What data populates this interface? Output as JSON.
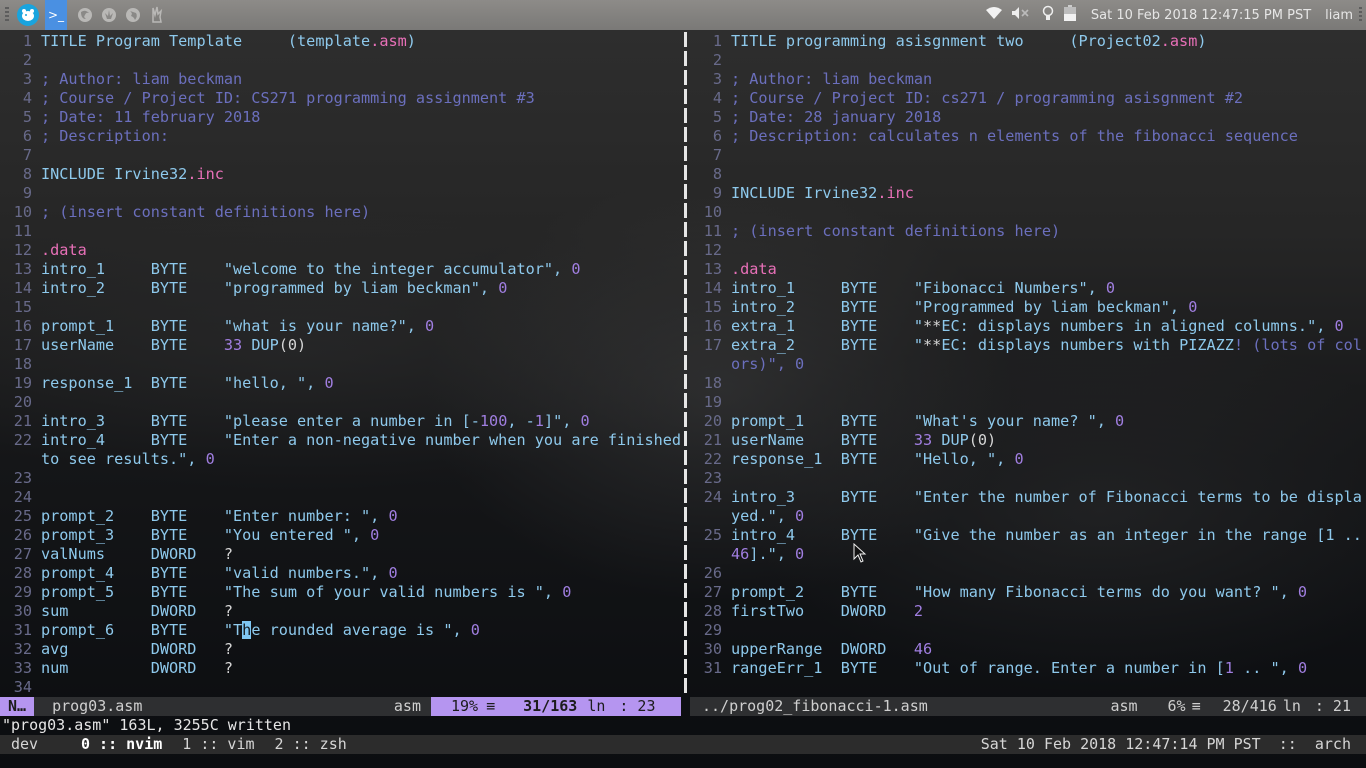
{
  "topbar": {
    "launcher_icons": [
      "app-logo",
      "terminal",
      "firefox",
      "rebel-alliance",
      "globe",
      "hand"
    ],
    "tray_icons": [
      "wifi",
      "volume-muted",
      "lightbulb",
      "battery"
    ],
    "clock": "Sat 10 Feb 2018 12:47:15 PM PST",
    "user": "liam"
  },
  "left_pane": {
    "lines": [
      {
        "n": "1",
        "parts": [
          [
            "kw",
            "TITLE Program Template     "
          ],
          [
            "kw",
            "(template"
          ],
          [
            "pk",
            ".asm"
          ],
          [
            "kw",
            ")"
          ]
        ]
      },
      {
        "n": "2",
        "parts": []
      },
      {
        "n": "3",
        "parts": [
          [
            "cm",
            "; Author: liam beckman"
          ]
        ]
      },
      {
        "n": "4",
        "parts": [
          [
            "cm",
            "; Course / Project ID: CS271 programming assignment #3"
          ]
        ]
      },
      {
        "n": "5",
        "parts": [
          [
            "cm",
            "; Date: 11 february 2018"
          ]
        ]
      },
      {
        "n": "6",
        "parts": [
          [
            "cm",
            "; Description:"
          ]
        ]
      },
      {
        "n": "7",
        "parts": []
      },
      {
        "n": "8",
        "parts": [
          [
            "kw",
            "INCLUDE Irvine32"
          ],
          [
            "pk",
            ".inc"
          ]
        ]
      },
      {
        "n": "9",
        "parts": []
      },
      {
        "n": "10",
        "parts": [
          [
            "cm",
            "; (insert constant definitions here)"
          ]
        ]
      },
      {
        "n": "11",
        "parts": []
      },
      {
        "n": "12",
        "parts": [
          [
            "pk",
            ".data"
          ]
        ]
      },
      {
        "n": "13",
        "parts": [
          [
            "kw",
            "intro_1     BYTE    \"welcome to the integer accumulator\", "
          ],
          [
            "num",
            "0"
          ]
        ]
      },
      {
        "n": "14",
        "parts": [
          [
            "kw",
            "intro_2     BYTE    \"programmed by liam beckman\", "
          ],
          [
            "num",
            "0"
          ]
        ]
      },
      {
        "n": "15",
        "parts": []
      },
      {
        "n": "16",
        "parts": [
          [
            "kw",
            "prompt_1    BYTE    \"what is your name?\", "
          ],
          [
            "num",
            "0"
          ]
        ]
      },
      {
        "n": "17",
        "parts": [
          [
            "kw",
            "userName    BYTE    "
          ],
          [
            "num",
            "33"
          ],
          [
            "kw",
            " DUP"
          ],
          [
            "wh",
            "(0)"
          ]
        ]
      },
      {
        "n": "18",
        "parts": []
      },
      {
        "n": "19",
        "parts": [
          [
            "kw",
            "response_1  BYTE    \"hello, \", "
          ],
          [
            "num",
            "0"
          ]
        ]
      },
      {
        "n": "20",
        "parts": []
      },
      {
        "n": "21",
        "parts": [
          [
            "kw",
            "intro_3     BYTE    \"please enter a number in [-"
          ],
          [
            "num",
            "100"
          ],
          [
            "kw",
            ", -"
          ],
          [
            "num",
            "1"
          ],
          [
            "kw",
            "]\", "
          ],
          [
            "num",
            "0"
          ]
        ]
      },
      {
        "n": "22",
        "parts": [
          [
            "kw",
            "intro_4     BYTE    \"Enter a non-negative number when you are finished to see results.\", "
          ],
          [
            "num",
            "0"
          ]
        ]
      },
      {
        "n": "23",
        "parts": []
      },
      {
        "n": "24",
        "parts": []
      },
      {
        "n": "25",
        "parts": [
          [
            "kw",
            "prompt_2    BYTE    \"Enter number: \", "
          ],
          [
            "num",
            "0"
          ]
        ]
      },
      {
        "n": "26",
        "parts": [
          [
            "kw",
            "prompt_3    BYTE    \"You entered \", "
          ],
          [
            "num",
            "0"
          ]
        ]
      },
      {
        "n": "27",
        "parts": [
          [
            "kw",
            "valNums     DWORD   "
          ],
          [
            "wh",
            "?"
          ]
        ]
      },
      {
        "n": "28",
        "parts": [
          [
            "kw",
            "prompt_4    BYTE    \"valid numbers.\", "
          ],
          [
            "num",
            "0"
          ]
        ]
      },
      {
        "n": "29",
        "parts": [
          [
            "kw",
            "prompt_5    BYTE    \"The sum of your valid numbers is \", "
          ],
          [
            "num",
            "0"
          ]
        ]
      },
      {
        "n": "30",
        "parts": [
          [
            "kw",
            "sum         DWORD   "
          ],
          [
            "wh",
            "?"
          ]
        ]
      },
      {
        "n": "31",
        "parts": [
          [
            "kw",
            "prompt_6    BYTE    \"T"
          ],
          [
            "cursor",
            "h"
          ],
          [
            "kw",
            "e rounded average is \", "
          ],
          [
            "num",
            "0"
          ]
        ]
      },
      {
        "n": "32",
        "parts": [
          [
            "kw",
            "avg         DWORD   "
          ],
          [
            "wh",
            "?"
          ]
        ]
      },
      {
        "n": "33",
        "parts": [
          [
            "kw",
            "num         DWORD   "
          ],
          [
            "wh",
            "?"
          ]
        ]
      },
      {
        "n": "34",
        "parts": []
      }
    ],
    "status": {
      "mode": "N…",
      "filename": "prog03.asm",
      "filetype": "asm",
      "percent": "19%",
      "percent_icon": "≡",
      "position": "31/163",
      "ln_label": "ln",
      "column": ": 23"
    }
  },
  "right_pane": {
    "lines": [
      {
        "n": "1",
        "parts": [
          [
            "kw",
            "TITLE programming asisgnment two     (Project02"
          ],
          [
            "pk",
            ".asm"
          ],
          [
            "kw",
            ")"
          ]
        ]
      },
      {
        "n": "2",
        "parts": []
      },
      {
        "n": "3",
        "parts": [
          [
            "cm",
            "; Author: liam beckman"
          ]
        ]
      },
      {
        "n": "4",
        "parts": [
          [
            "cm",
            "; Course / Project ID: cs271 / programming asisgnment #2"
          ]
        ]
      },
      {
        "n": "5",
        "parts": [
          [
            "cm",
            "; Date: 28 january 2018"
          ]
        ]
      },
      {
        "n": "6",
        "parts": [
          [
            "cm",
            "; Description: calculates n elements of the fibonacci sequence"
          ]
        ]
      },
      {
        "n": "7",
        "parts": []
      },
      {
        "n": "8",
        "parts": []
      },
      {
        "n": "9",
        "parts": [
          [
            "kw",
            "INCLUDE Irvine32"
          ],
          [
            "pk",
            ".inc"
          ]
        ]
      },
      {
        "n": "10",
        "parts": []
      },
      {
        "n": "11",
        "parts": [
          [
            "cm",
            "; (insert constant definitions here)"
          ]
        ]
      },
      {
        "n": "12",
        "parts": []
      },
      {
        "n": "13",
        "parts": [
          [
            "pk",
            ".data"
          ]
        ]
      },
      {
        "n": "14",
        "parts": [
          [
            "kw",
            "intro_1     BYTE    \"Fibonacci Numbers\", "
          ],
          [
            "num",
            "0"
          ]
        ]
      },
      {
        "n": "15",
        "parts": [
          [
            "kw",
            "intro_2     BYTE    \"Programmed by liam beckman\", "
          ],
          [
            "num",
            "0"
          ]
        ]
      },
      {
        "n": "16",
        "parts": [
          [
            "kw",
            "extra_1     BYTE    \""
          ],
          [
            "wh",
            "**"
          ],
          [
            "kw",
            "EC: displays numbers in aligned columns.\", "
          ],
          [
            "num",
            "0"
          ]
        ]
      },
      {
        "n": "17",
        "parts": [
          [
            "kw",
            "extra_2     BYTE    \""
          ],
          [
            "wh",
            "**"
          ],
          [
            "kw",
            "EC: displays numbers with PIZAZZ"
          ],
          [
            "cm",
            "! (lots of colors)\", 0"
          ]
        ]
      },
      {
        "n": "18",
        "parts": []
      },
      {
        "n": "19",
        "parts": []
      },
      {
        "n": "20",
        "parts": [
          [
            "kw",
            "prompt_1    BYTE    \"What's your name? \", "
          ],
          [
            "num",
            "0"
          ]
        ]
      },
      {
        "n": "21",
        "parts": [
          [
            "kw",
            "userName    BYTE    "
          ],
          [
            "num",
            "33"
          ],
          [
            "kw",
            " DUP"
          ],
          [
            "wh",
            "(0)"
          ]
        ]
      },
      {
        "n": "22",
        "parts": [
          [
            "kw",
            "response_1  BYTE    \"Hello, \", "
          ],
          [
            "num",
            "0"
          ]
        ]
      },
      {
        "n": "23",
        "parts": []
      },
      {
        "n": "24",
        "parts": [
          [
            "kw",
            "intro_3     BYTE    \"Enter the number of Fibonacci terms to be displayed.\", "
          ],
          [
            "num",
            "0"
          ]
        ]
      },
      {
        "n": "25",
        "parts": [
          [
            "kw",
            "intro_4     BYTE    \"Give the number as an integer in the range [1 .. "
          ],
          [
            "num",
            "46"
          ],
          [
            "kw",
            "].\", "
          ],
          [
            "num",
            "0"
          ]
        ]
      },
      {
        "n": "26",
        "parts": []
      },
      {
        "n": "27",
        "parts": [
          [
            "kw",
            "prompt_2    BYTE    \"How many Fibonacci terms do you want? \", "
          ],
          [
            "num",
            "0"
          ]
        ]
      },
      {
        "n": "28",
        "parts": [
          [
            "kw",
            "firstTwo    DWORD   "
          ],
          [
            "num",
            "2"
          ]
        ]
      },
      {
        "n": "29",
        "parts": []
      },
      {
        "n": "30",
        "parts": [
          [
            "kw",
            "upperRange  DWORD   "
          ],
          [
            "num",
            "46"
          ]
        ]
      },
      {
        "n": "31",
        "parts": [
          [
            "kw",
            "rangeErr_1  BYTE    \"Out of range. Enter a number in ["
          ],
          [
            "num",
            "1"
          ],
          [
            "kw",
            " .. \", "
          ],
          [
            "num",
            "0"
          ]
        ]
      }
    ],
    "status": {
      "filename": "../prog02_fibonacci-1.asm",
      "filetype": "asm",
      "percent": "6%",
      "percent_icon": "≡",
      "position": "28/416",
      "ln_label": "ln",
      "column": ": 21"
    }
  },
  "command_line": "\"prog03.asm\" 163L, 3255C written",
  "tmux": {
    "session": "dev",
    "windows": [
      {
        "label": "0 :: nvim",
        "active": true
      },
      {
        "label": "1 :: vim",
        "active": false
      },
      {
        "label": "2 :: zsh",
        "active": false
      }
    ],
    "status_right": "Sat 10 Feb 2018 12:47:14 PM PST  ::  arch"
  },
  "colors": {
    "keyword": "#8ec9ec",
    "comment": "#6b6fbd",
    "pink": "#e870b8",
    "number": "#a07ee0",
    "statusline_accent": "#b595f0",
    "line_number": "#686a8a"
  }
}
